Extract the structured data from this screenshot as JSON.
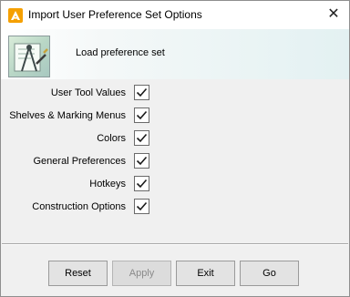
{
  "window": {
    "title": "Import User Preference Set Options",
    "close_glyph": "✕"
  },
  "header": {
    "label": "Load preference set",
    "icon": "preference-set-icon"
  },
  "options": [
    {
      "label": "User Tool Values",
      "checked": true
    },
    {
      "label": "Shelves & Marking Menus",
      "checked": true
    },
    {
      "label": "Colors",
      "checked": true
    },
    {
      "label": "General Preferences",
      "checked": true
    },
    {
      "label": "Hotkeys",
      "checked": true
    },
    {
      "label": "Construction Options",
      "checked": true
    }
  ],
  "buttons": {
    "reset": "Reset",
    "apply": "Apply",
    "exit": "Exit",
    "go": "Go"
  },
  "colors": {
    "app_icon_bg": "#f5a000",
    "check": "#1a1a1a"
  }
}
